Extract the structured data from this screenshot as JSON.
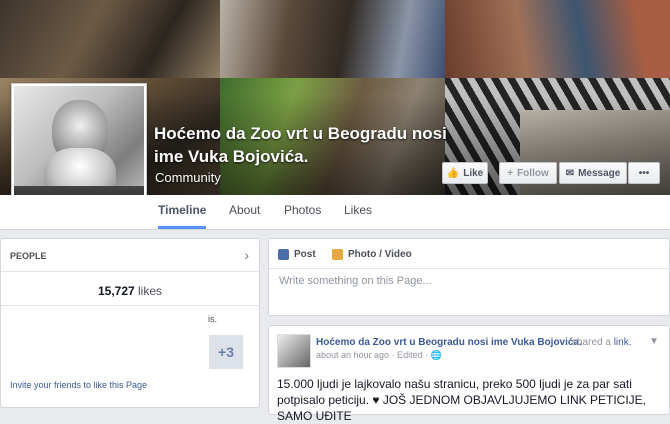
{
  "page": {
    "name": "Hoćemo da Zoo vrt u Beogradu nosi ime Vuka Bojovića.",
    "category": "Community"
  },
  "actions": {
    "like": "Like",
    "follow": "Follow",
    "message": "Message",
    "more": "•••"
  },
  "tabs": [
    {
      "label": "Timeline",
      "active": true
    },
    {
      "label": "About"
    },
    {
      "label": "Photos"
    },
    {
      "label": "Likes"
    }
  ],
  "people": {
    "heading": "PEOPLE",
    "likes_count": "15,727",
    "likes_word": "likes",
    "text_fragment": "is.",
    "more_badge": "+3",
    "invite": "Invite your friends to like this Page"
  },
  "composer": {
    "post_tab": "Post",
    "photo_tab": "Photo / Video",
    "placeholder": "Write something on this Page..."
  },
  "post": {
    "author": "Hoćemo da Zoo vrt u Beogradu nosi ime Vuka Bojovića.",
    "shared": "shared a",
    "shared_link": "link.",
    "time": "about an hour ago · Edited · ",
    "text": "15.000 ljudi je lajkovalo našu stranicu, preko 500 ljudi je za par sati potpisalo peticiju. ♥ JOŠ JEDNOM OBJAVLJUJEMO LINK PETICIJE, SAMO UĐITE"
  },
  "colors": {
    "fb_blue": "#3b5998",
    "tab_active_underline": "#5890ff",
    "background": "#e9eaed"
  }
}
